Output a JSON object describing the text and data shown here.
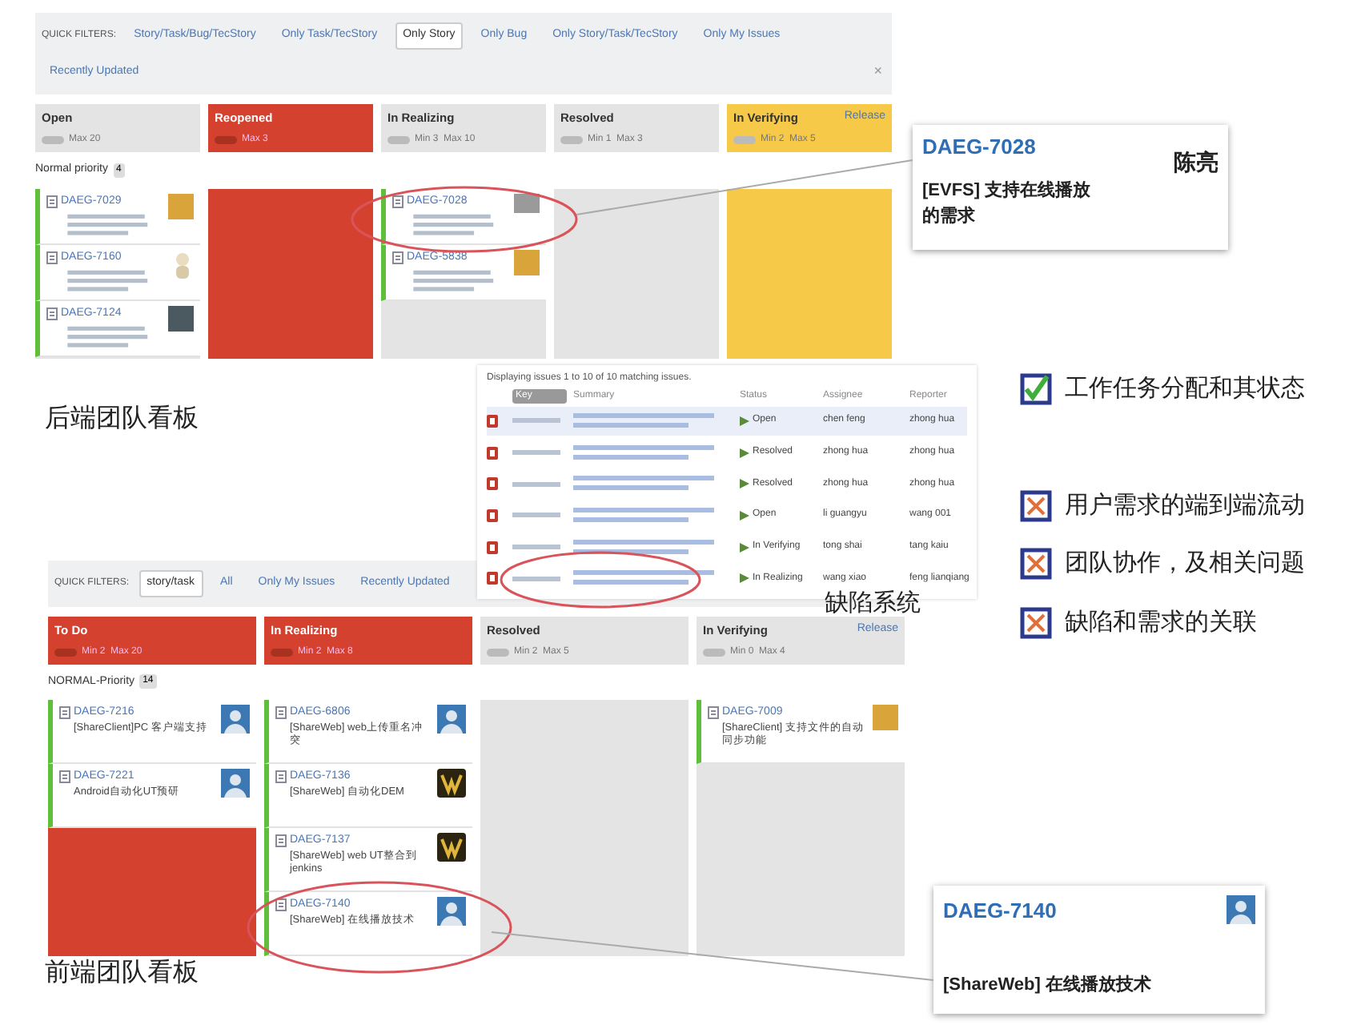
{
  "top_board": {
    "quick_filters": {
      "label": "QUICK FILTERS:",
      "items": [
        {
          "label": "Story/Task/Bug/TecStory",
          "selected": false
        },
        {
          "label": "Only Task/TecStory",
          "selected": false
        },
        {
          "label": "Only Story",
          "selected": true
        },
        {
          "label": "Only Bug",
          "selected": false
        },
        {
          "label": "Only Story/Task/TecStory",
          "selected": false
        },
        {
          "label": "Only My Issues",
          "selected": false
        },
        {
          "label": "Recently Updated",
          "selected": false
        }
      ],
      "close": "×"
    },
    "columns": [
      {
        "name": "Open",
        "limits": "Max 20",
        "color": "#e4e4e4",
        "cards": [
          {
            "key": "DAEG-7029",
            "kind": "pattern"
          },
          {
            "key": "DAEG-7160",
            "kind": "figure"
          },
          {
            "key": "DAEG-7124",
            "kind": "photo"
          }
        ]
      },
      {
        "name": "Reopened",
        "limits": "Max 3",
        "color": "#d4412f"
      },
      {
        "name": "In Realizing",
        "limits": "Min 3  Max 10",
        "color": "#e4e4e4",
        "cards": [
          {
            "key": "DAEG-7028",
            "kind": "signature"
          },
          {
            "key": "DAEG-5838",
            "kind": "pattern"
          }
        ]
      },
      {
        "name": "Resolved",
        "limits": "Min 1  Max 3",
        "color": "#e4e4e4"
      },
      {
        "name": "In Verifying",
        "limits": "Min 2  Max 5",
        "action": "Release",
        "color": "#f7c948"
      }
    ],
    "swimlane": {
      "label": "Normal priority",
      "count": "4"
    }
  },
  "issue_list": {
    "caption": "Displaying issues 1 to 10 of 10 matching issues.",
    "columns": [
      "Key",
      "Summary",
      "Status",
      "Assignee",
      "Reporter"
    ],
    "rows": [
      {
        "status": "Open",
        "assignee": "chen feng",
        "reporter": "zhong hua",
        "selected": true
      },
      {
        "status": "Resolved",
        "assignee": "zhong hua",
        "reporter": "zhong hua",
        "selected": false
      },
      {
        "status": "Resolved",
        "assignee": "zhong hua",
        "reporter": "zhong hua",
        "selected": false
      },
      {
        "status": "Open",
        "assignee": "li guangyu",
        "reporter": "wang 001",
        "selected": false
      },
      {
        "status": "In Verifying",
        "assignee": "tong shai",
        "reporter": "tang kaiu",
        "selected": false
      },
      {
        "status": "In Realizing",
        "assignee": "wang xiao",
        "reporter": "feng lianqiang",
        "selected": false
      }
    ]
  },
  "callout_top": {
    "key": "DAEG-7028",
    "summary": "[EVFS] 支持在线播放的需求",
    "signature": "陈亮"
  },
  "caption_backend": "后端团队看板",
  "caption_defects": "缺陷系统",
  "checklist": [
    {
      "label": "工作任务分配和其状态",
      "checked": true
    },
    {
      "label": "用户需求的端到端流动",
      "checked": false
    },
    {
      "label": "团队协作，及相关问题",
      "checked": false
    },
    {
      "label": "缺陷和需求的关联",
      "checked": false
    }
  ],
  "bottom_board": {
    "quick_filters": {
      "label": "QUICK FILTERS:",
      "items": [
        {
          "label": "story/task",
          "selected": true
        },
        {
          "label": "All",
          "selected": false
        },
        {
          "label": "Only My Issues",
          "selected": false
        },
        {
          "label": "Recently Updated",
          "selected": false
        }
      ]
    },
    "columns": [
      {
        "name": "To Do",
        "limits": "Min 2  Max 20",
        "color": "#d4412f",
        "cards": [
          {
            "key": "DAEG-7216",
            "summary": "[ShareClient]PC 客户端支持",
            "kind": "person"
          },
          {
            "key": "DAEG-7221",
            "summary": "Android自动化UT预研",
            "kind": "person"
          }
        ]
      },
      {
        "name": "In Realizing",
        "limits": "Min 2  Max 8",
        "color": "#d4412f",
        "cards": [
          {
            "key": "DAEG-6806",
            "summary": "[ShareWeb] web上传重名冲突",
            "kind": "person"
          },
          {
            "key": "DAEG-7136",
            "summary": "[ShareWeb] 自动化DEM",
            "kind": "logo"
          },
          {
            "key": "DAEG-7137",
            "summary": "[ShareWeb] web UT整合到jenkins",
            "kind": "logo"
          },
          {
            "key": "DAEG-7140",
            "summary": "[ShareWeb] 在线播放技术",
            "kind": "person"
          }
        ]
      },
      {
        "name": "Resolved",
        "limits": "Min 2  Max 5",
        "color": "#e4e4e4"
      },
      {
        "name": "In Verifying",
        "limits": "Min 0  Max 4",
        "action": "Release",
        "color": "#e4e4e4",
        "cards": [
          {
            "key": "DAEG-7009",
            "summary": "[ShareClient] 支持文件的自动同步功能",
            "kind": "pattern"
          }
        ]
      }
    ],
    "swimlane": {
      "label": "NORMAL-Priority",
      "count": "14"
    }
  },
  "caption_frontend": "前端团队看板",
  "callout_bottom": {
    "key": "DAEG-7140",
    "summary": "[ShareWeb] 在线播放技术"
  }
}
